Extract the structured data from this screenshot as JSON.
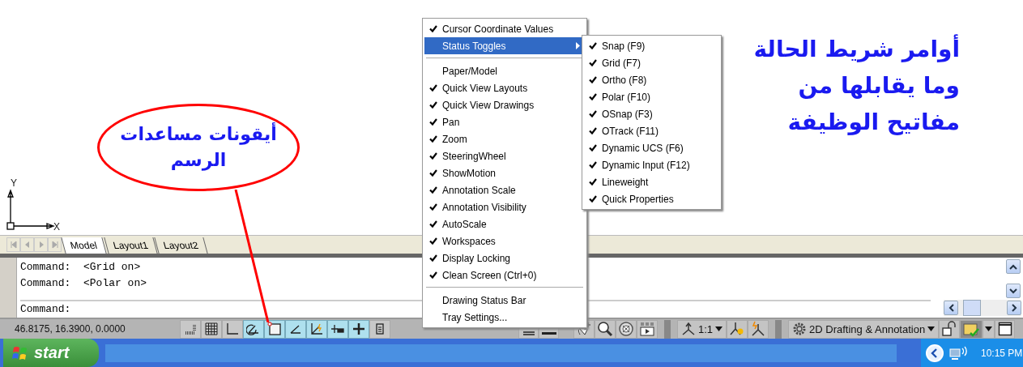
{
  "drawing": {
    "ucs_axes": {
      "x": "X",
      "y": "Y"
    },
    "callout": {
      "lines": [
        "أيقونات مساعدات",
        "الرسم"
      ]
    },
    "note": {
      "lines": [
        "أوامر شريط الحالة",
        "وما يقابلها من",
        "مفاتيح الوظيفة"
      ]
    }
  },
  "layout_tabs": [
    {
      "label": "Model",
      "selected": true
    },
    {
      "label": "Layout1",
      "selected": false
    },
    {
      "label": "Layout2",
      "selected": false
    }
  ],
  "command_window": {
    "history": [
      "Command:  <Grid on>",
      "Command:  <Polar on>"
    ],
    "prompt": "Command:"
  },
  "status_bar": {
    "coordinates": "46.8175, 16.3900, 0.0000",
    "toggles": [
      {
        "kind": "snap",
        "on": false
      },
      {
        "kind": "grid",
        "on": false
      },
      {
        "kind": "ortho",
        "on": false
      },
      {
        "kind": "polar",
        "on": true
      },
      {
        "kind": "osnap",
        "on": true
      },
      {
        "kind": "otrack",
        "on": true
      },
      {
        "kind": "ducs",
        "on": true
      },
      {
        "kind": "dyn",
        "on": true
      },
      {
        "kind": "lwt",
        "on": true
      },
      {
        "kind": "qp",
        "on": false
      }
    ],
    "annotation_scale": "1:1",
    "workspace": "2D Drafting & Annotation"
  },
  "context_menu": {
    "sections": [
      [
        {
          "label": "Cursor Coordinate Values",
          "checked": true,
          "submenu": false,
          "selected": false
        },
        {
          "label": "Status Toggles",
          "checked": false,
          "submenu": true,
          "selected": true
        }
      ],
      [
        {
          "label": "Paper/Model",
          "checked": false,
          "submenu": false,
          "selected": false
        },
        {
          "label": "Quick View Layouts",
          "checked": true,
          "submenu": false,
          "selected": false
        },
        {
          "label": "Quick View Drawings",
          "checked": true,
          "submenu": false,
          "selected": false
        },
        {
          "label": "Pan",
          "checked": true,
          "submenu": false,
          "selected": false
        },
        {
          "label": "Zoom",
          "checked": true,
          "submenu": false,
          "selected": false
        },
        {
          "label": "SteeringWheel",
          "checked": true,
          "submenu": false,
          "selected": false
        },
        {
          "label": "ShowMotion",
          "checked": true,
          "submenu": false,
          "selected": false
        },
        {
          "label": "Annotation Scale",
          "checked": true,
          "submenu": false,
          "selected": false
        },
        {
          "label": "Annotation Visibility",
          "checked": true,
          "submenu": false,
          "selected": false
        },
        {
          "label": "AutoScale",
          "checked": true,
          "submenu": false,
          "selected": false
        },
        {
          "label": "Workspaces",
          "checked": true,
          "submenu": false,
          "selected": false
        },
        {
          "label": "Display Locking",
          "checked": true,
          "submenu": false,
          "selected": false
        },
        {
          "label": "Clean Screen (Ctrl+0)",
          "checked": true,
          "submenu": false,
          "selected": false
        }
      ],
      [
        {
          "label": "Drawing Status Bar",
          "checked": false,
          "submenu": false,
          "selected": false
        },
        {
          "label": "Tray Settings...",
          "checked": false,
          "submenu": false,
          "selected": false
        }
      ]
    ],
    "submenu": [
      {
        "label": "Snap (F9)",
        "checked": true
      },
      {
        "label": "Grid (F7)",
        "checked": true
      },
      {
        "label": "Ortho (F8)",
        "checked": true
      },
      {
        "label": "Polar (F10)",
        "checked": true
      },
      {
        "label": "OSnap (F3)",
        "checked": true
      },
      {
        "label": "OTrack (F11)",
        "checked": true
      },
      {
        "label": "Dynamic UCS (F6)",
        "checked": true
      },
      {
        "label": "Dynamic Input (F12)",
        "checked": true
      },
      {
        "label": "Lineweight",
        "checked": true
      },
      {
        "label": "Quick Properties",
        "checked": true
      }
    ]
  },
  "taskbar": {
    "start": "start",
    "clock": "10:15 PM"
  }
}
